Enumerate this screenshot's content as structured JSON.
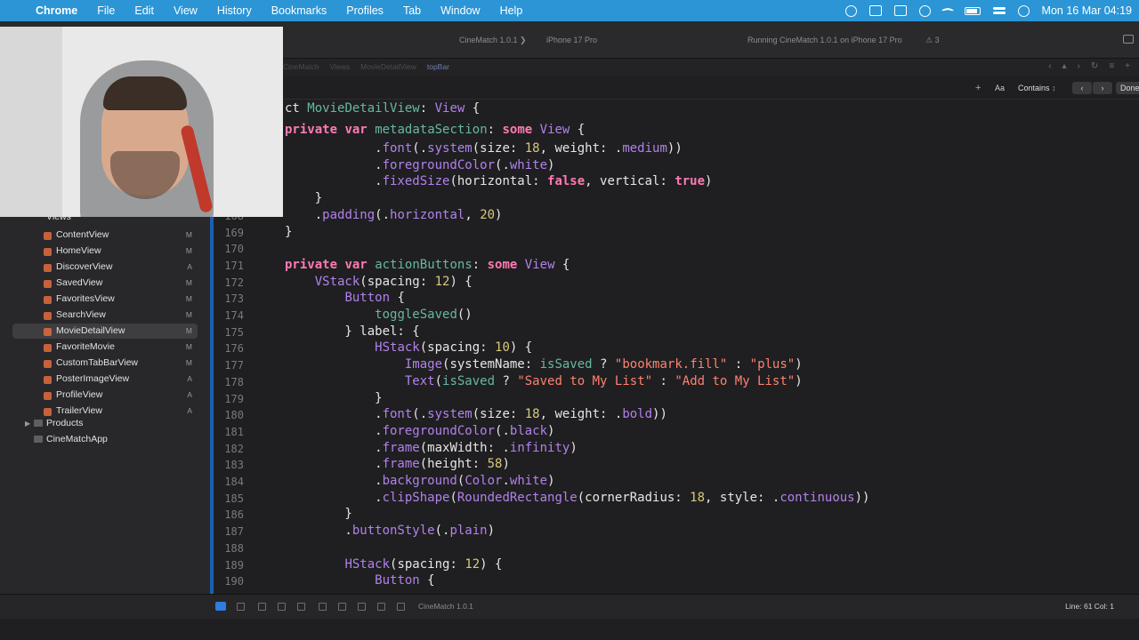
{
  "menubar": {
    "app_name": "Chrome",
    "items": [
      "File",
      "Edit",
      "View",
      "History",
      "Bookmarks",
      "Profiles",
      "Tab",
      "Window",
      "Help"
    ],
    "clock": "Mon 16 Mar  04:19"
  },
  "toolbar": {
    "scheme": "CineMatch 1.0.1  ❯",
    "device": "iPhone 17 Pro",
    "status": "Running CineMatch 1.0.1 on iPhone 17 Pro",
    "warnings": "⚠ 3"
  },
  "jumpbar": {
    "crumbs": [
      "CineMatch",
      "Views",
      "MovieDetailView"
    ],
    "current": "topBar"
  },
  "findbar": {
    "plus": "+",
    "match_case": "Aa",
    "mode": "Contains",
    "prev": "‹",
    "next": "›",
    "done": "Done"
  },
  "navigator": {
    "group_label": "Views",
    "files": [
      {
        "name": "ContentView",
        "status": "M"
      },
      {
        "name": "HomeView",
        "status": "M"
      },
      {
        "name": "DiscoverView",
        "status": "A"
      },
      {
        "name": "SavedView",
        "status": "M"
      },
      {
        "name": "FavoritesView",
        "status": "M"
      },
      {
        "name": "SearchView",
        "status": "M"
      },
      {
        "name": "MovieDetailView",
        "status": "M"
      },
      {
        "name": "FavoriteMovie",
        "status": "M"
      },
      {
        "name": "CustomTabBarView",
        "status": "M"
      },
      {
        "name": "PosterImageView",
        "status": "A"
      },
      {
        "name": "ProfileView",
        "status": "A"
      },
      {
        "name": "TrailerView",
        "status": "A"
      }
    ],
    "selected_index": 6,
    "groups": [
      "Products",
      "CineMatchApp"
    ]
  },
  "editor": {
    "sticky": [
      "ct MovieDetailView: View {",
      "private var metadataSection: some View {"
    ],
    "lines": [
      {
        "n": "",
        "t": "            .font(.system(size: 18, weight: .medium))"
      },
      {
        "n": "",
        "t": "            .foregroundColor(.white)"
      },
      {
        "n": "",
        "t": "            .fixedSize(horizontal: false, vertical: true)"
      },
      {
        "n": "",
        "t": "    }"
      },
      {
        "n": "168",
        "t": "    .padding(.horizontal, 20)"
      },
      {
        "n": "169",
        "t": "}"
      },
      {
        "n": "170",
        "t": ""
      },
      {
        "n": "171",
        "t": "private var actionButtons: some View {"
      },
      {
        "n": "172",
        "t": "    VStack(spacing: 12) {"
      },
      {
        "n": "173",
        "t": "        Button {"
      },
      {
        "n": "174",
        "t": "            toggleSaved()"
      },
      {
        "n": "175",
        "t": "        } label: {"
      },
      {
        "n": "176",
        "t": "            HStack(spacing: 10) {"
      },
      {
        "n": "177",
        "t": "                Image(systemName: isSaved ? \"bookmark.fill\" : \"plus\")"
      },
      {
        "n": "178",
        "t": "                Text(isSaved ? \"Saved to My List\" : \"Add to My List\")"
      },
      {
        "n": "179",
        "t": "            }"
      },
      {
        "n": "180",
        "t": "            .font(.system(size: 18, weight: .bold))"
      },
      {
        "n": "181",
        "t": "            .foregroundColor(.black)"
      },
      {
        "n": "182",
        "t": "            .frame(maxWidth: .infinity)"
      },
      {
        "n": "183",
        "t": "            .frame(height: 58)"
      },
      {
        "n": "184",
        "t": "            .background(Color.white)"
      },
      {
        "n": "185",
        "t": "            .clipShape(RoundedRectangle(cornerRadius: 18, style: .continuous))"
      },
      {
        "n": "186",
        "t": "        }"
      },
      {
        "n": "187",
        "t": "        .buttonStyle(.plain)"
      },
      {
        "n": "188",
        "t": ""
      },
      {
        "n": "189",
        "t": "        HStack(spacing: 12) {"
      },
      {
        "n": "190",
        "t": "            Button {"
      }
    ]
  },
  "debugbar": {
    "scheme": "CineMatch 1.0.1",
    "position": "Line: 61  Col: 1"
  },
  "colors": {
    "menubar_bg": "#2b95d6",
    "editor_bg": "#1f1f21",
    "keyword": "#ff7ab2",
    "string": "#ff8170",
    "number": "#d9c97c",
    "property": "#b281eb",
    "type": "#67b7a4"
  },
  "icons": [
    "apple-icon",
    "wifi-icon",
    "battery-icon",
    "control-center-icon",
    "sidebar-toggle-icon",
    "chevron-left-icon",
    "chevron-right-icon",
    "folder-icon",
    "swift-file-icon",
    "disclosure-chevron-icon"
  ]
}
